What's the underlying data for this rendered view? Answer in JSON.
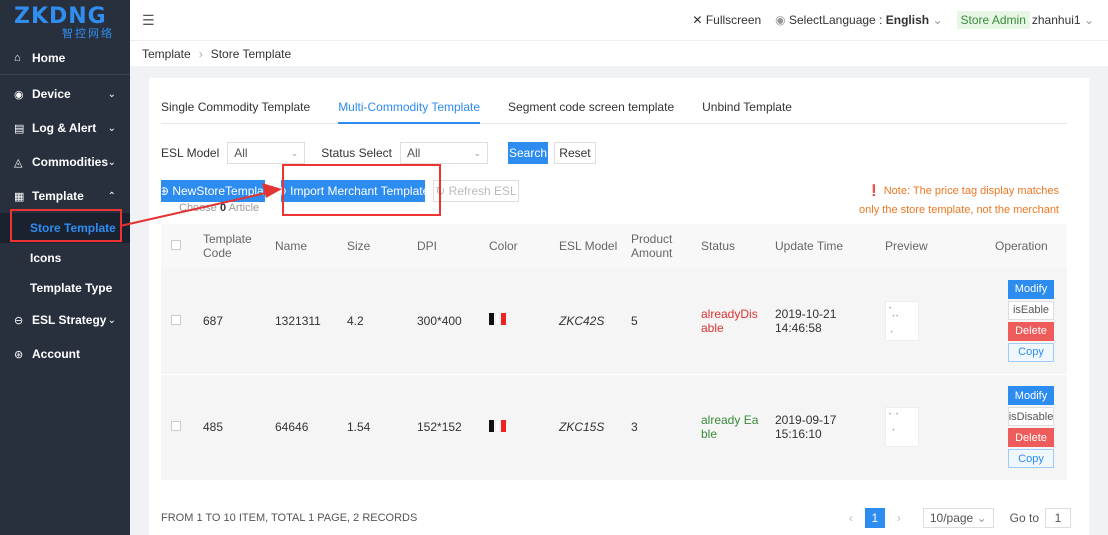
{
  "logo": {
    "brand": "ZKDNG",
    "sub": "智控网络"
  },
  "sidebar": {
    "items": [
      {
        "label": "Home",
        "icon": "⌂"
      },
      {
        "label": "Device",
        "icon": "◉"
      },
      {
        "label": "Log & Alert",
        "icon": "▤"
      },
      {
        "label": "Commodities",
        "icon": "◬"
      },
      {
        "label": "Template",
        "icon": "▦"
      }
    ],
    "sub_items": [
      {
        "label": "Store Template"
      },
      {
        "label": "Icons"
      },
      {
        "label": "Template Type"
      }
    ],
    "bottom_items": [
      {
        "label": "ESL Strategy",
        "icon": "⊖"
      },
      {
        "label": "Account",
        "icon": "⊛"
      }
    ]
  },
  "topbar": {
    "toggle_icon": "☰",
    "fullscreen": "Fullscreen",
    "lang_label": "SelectLanguage :",
    "lang_value": "English",
    "role": "Store Admin",
    "user": "zhanhui1"
  },
  "breadcrumb": {
    "root": "Template",
    "current": "Store Template"
  },
  "tabs": [
    {
      "label": "Single Commodity Template"
    },
    {
      "label": "Multi-Commodity Template"
    },
    {
      "label": "Segment code screen template"
    },
    {
      "label": "Unbind Template"
    }
  ],
  "filters": {
    "esl_model_label": "ESL Model",
    "esl_model_value": "All",
    "status_label": "Status Select",
    "status_value": "All",
    "search": "Search",
    "reset": "Reset"
  },
  "actions": {
    "new_store": "NewStoreTemplat",
    "import_merchant": "Import Merchant Template",
    "refresh": "Refresh ESL"
  },
  "choose": {
    "prefix": "Choose",
    "count": "0",
    "suffix": "Article"
  },
  "note": "Note: The price tag display matches only the store template, not the merchant template",
  "table": {
    "headers": [
      "Template Code",
      "Name",
      "Size",
      "DPI",
      "Color",
      "ESL Model",
      "Product Amount",
      "Status",
      "Update Time",
      "Preview",
      "Operation"
    ],
    "rows": [
      {
        "code": "687",
        "name": "1321311",
        "size": "4.2",
        "dpi": "300*400",
        "model": "ZKC42S",
        "amount": "5",
        "status": "alreadyDisable",
        "time": "2019-10-21 14:46:58",
        "toggle": "isEable"
      },
      {
        "code": "485",
        "name": "64646",
        "size": "1.54",
        "dpi": "152*152",
        "model": "ZKC15S",
        "amount": "3",
        "status": "already Eable",
        "time": "2019-09-17 15:16:10",
        "toggle": "isDisable"
      }
    ],
    "ops": {
      "modify": "Modify",
      "delete": "Delete",
      "copy": "Copy"
    }
  },
  "footer": {
    "summary": "FROM 1 TO 10 ITEM,  TOTAL 1 PAGE,  2 RECORDS",
    "page": "1",
    "page_size": "10/page",
    "goto_label": "Go to",
    "goto_value": "1"
  },
  "colors": {
    "accent": "#2d8cf0",
    "danger": "#ee5b5b",
    "sidebar": "#28303d",
    "highlight": "#e33333"
  }
}
